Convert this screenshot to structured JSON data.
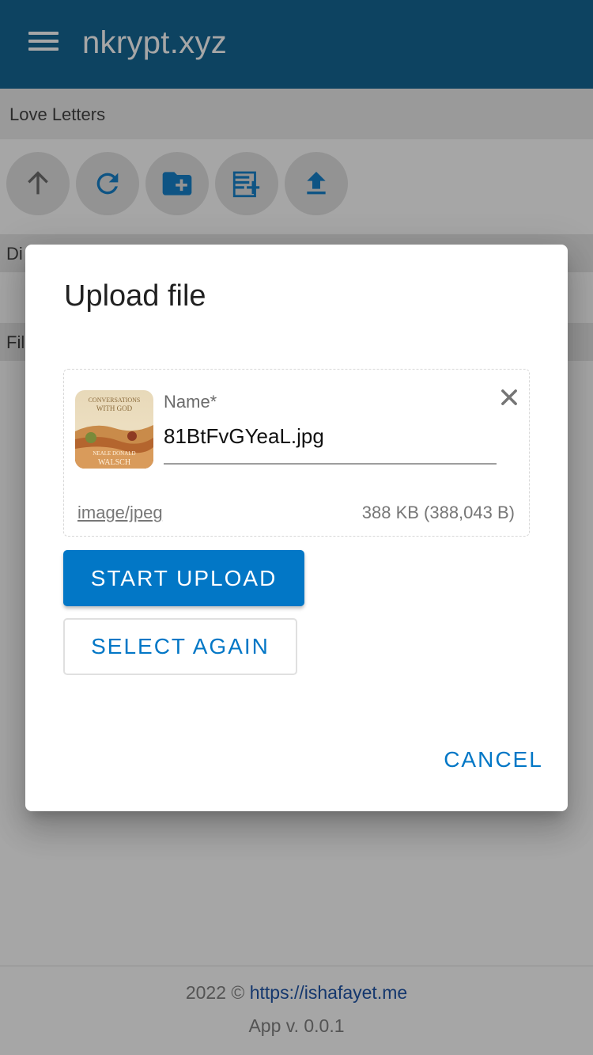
{
  "app": {
    "title": "nkrypt.xyz"
  },
  "breadcrumb": {
    "current": "Love Letters"
  },
  "toolbar": {
    "buttons": [
      {
        "icon": "arrow-up-icon"
      },
      {
        "icon": "refresh-icon"
      },
      {
        "icon": "new-folder-icon"
      },
      {
        "icon": "new-note-icon"
      },
      {
        "icon": "upload-icon"
      }
    ]
  },
  "sections": {
    "directories_label": "Di",
    "files_label": "Fil"
  },
  "dialog": {
    "title": "Upload file",
    "file": {
      "name_label": "Name*",
      "name_value": "81BtFvGYeaL.jpg",
      "mime_type": "image/jpeg",
      "size": "388 KB (388,043 B)",
      "thumbnail_text": [
        "CONVERSATIONS",
        "WITH GOD",
        "NEALE DONALD",
        "WALSCH"
      ]
    },
    "start_upload_label": "START UPLOAD",
    "select_again_label": "SELECT AGAIN",
    "cancel_label": "CANCEL"
  },
  "footer": {
    "copyright_prefix": "2022 ©",
    "link_text": "https://ishafayet.me",
    "version": "App v. 0.0.1"
  },
  "colors": {
    "primary": "#005a8c",
    "accent": "#0277c6",
    "link": "#0d47a1"
  }
}
